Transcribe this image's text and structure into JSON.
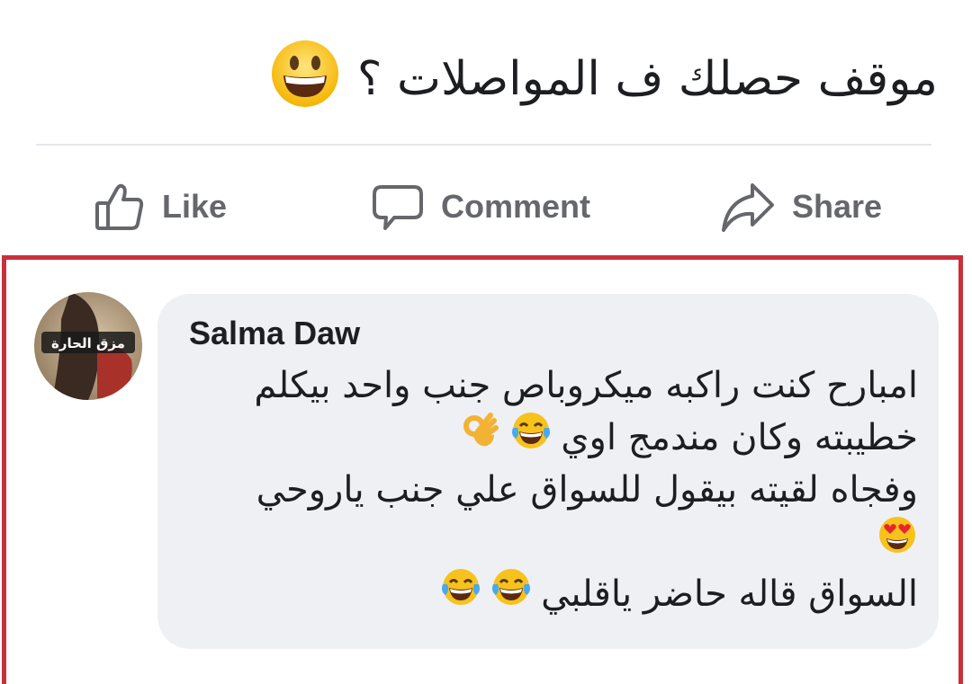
{
  "post": {
    "text": "موقف حصلك ف المواصلات ؟",
    "emoji": "grinning-face"
  },
  "actions": {
    "like_label": "Like",
    "comment_label": "Comment",
    "share_label": "Share"
  },
  "comment": {
    "avatar_badge": "مزق الحارة",
    "author": "Salma Daw",
    "lines": [
      {
        "text": "امبارح كنت راكبه ميكروباص جنب واحد بيكلم",
        "emojis": []
      },
      {
        "text": "خطيبته وكان مندمج اوي",
        "emojis": [
          "face-with-tears-of-joy",
          "ok-hand"
        ]
      },
      {
        "text": "وفجاه لقيته بيقول للسواق علي جنب ياروحي",
        "emojis": []
      },
      {
        "text": "",
        "emojis": [
          "smiling-face-with-heart-eyes"
        ]
      },
      {
        "text": "السواق قاله حاضر ياقلبي",
        "emojis": [
          "face-with-tears-of-joy",
          "face-with-tears-of-joy"
        ]
      }
    ]
  },
  "colors": {
    "highlight_border": "#c8303a",
    "bubble_bg": "#eef0f4",
    "action_text": "#65676b"
  }
}
